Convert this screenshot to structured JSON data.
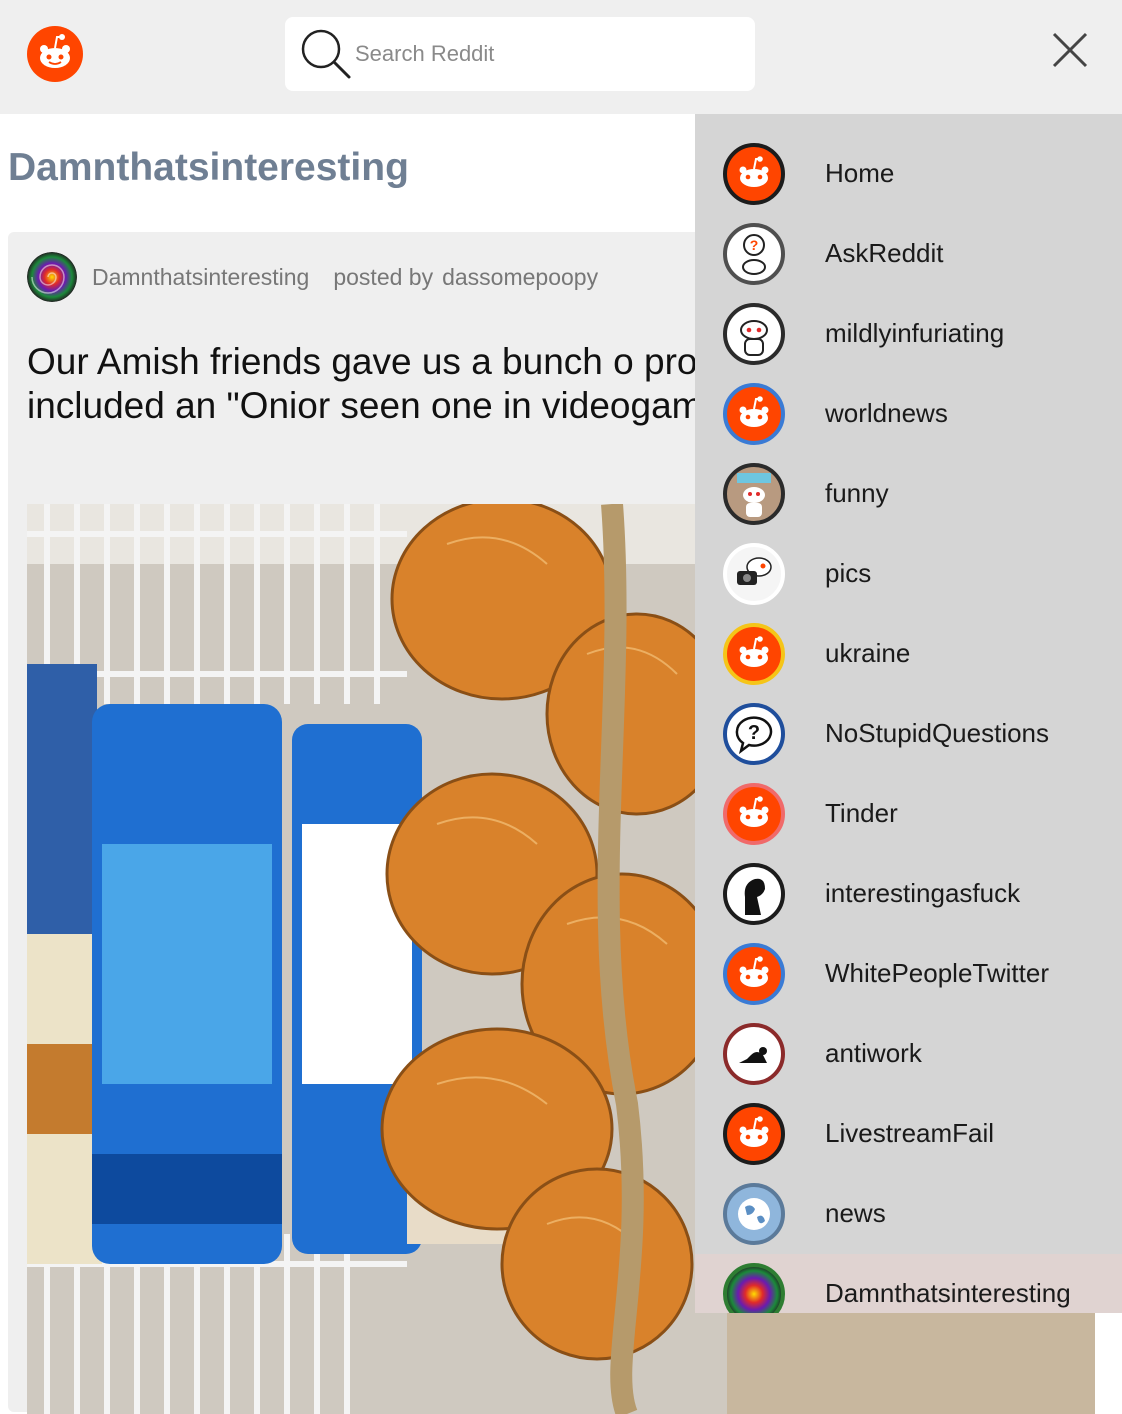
{
  "header": {
    "search_placeholder": "Search Reddit"
  },
  "page": {
    "subreddit_title": "Damnthatsinteresting"
  },
  "post": {
    "subreddit": "Damnthatsinteresting",
    "posted_by_label": "posted by",
    "author": "dassomepoopy",
    "title": "Our Amish friends gave us a bunch o produce and they included an \"Onior seen one in videogames."
  },
  "drawer": {
    "items": [
      {
        "label": "Home",
        "icon": "reddit-snoo-icon",
        "ring": "#1c1c1c"
      },
      {
        "label": "AskReddit",
        "icon": "askreddit-icon",
        "ring": "#4f4f4f"
      },
      {
        "label": "mildlyinfuriating",
        "icon": "mildlyinfuriating-icon",
        "ring": "#2b2b2b"
      },
      {
        "label": "worldnews",
        "icon": "reddit-snoo-icon",
        "ring": "#3a7bd5"
      },
      {
        "label": "funny",
        "icon": "funny-icon",
        "ring": "#2b2b2b"
      },
      {
        "label": "pics",
        "icon": "pics-icon",
        "ring": "#ffffff"
      },
      {
        "label": "ukraine",
        "icon": "reddit-snoo-icon",
        "ring": "#f5c518"
      },
      {
        "label": "NoStupidQuestions",
        "icon": "question-bubble-icon",
        "ring": "#1f4e9c"
      },
      {
        "label": "Tinder",
        "icon": "reddit-snoo-icon",
        "ring": "#f06a6a"
      },
      {
        "label": "interestingasfuck",
        "icon": "thinker-icon",
        "ring": "#1c1c1c"
      },
      {
        "label": "WhitePeopleTwitter",
        "icon": "reddit-snoo-icon",
        "ring": "#3a7bd5"
      },
      {
        "label": "antiwork",
        "icon": "antiwork-icon",
        "ring": "#8b2a2a"
      },
      {
        "label": "LivestreamFail",
        "icon": "reddit-snoo-icon",
        "ring": "#1c1c1c"
      },
      {
        "label": "news",
        "icon": "globe-icon",
        "ring": "#5b7a9a"
      },
      {
        "label": "Damnthatsinteresting",
        "icon": "swirl-icon",
        "ring": "#2e7d32",
        "active": true
      }
    ]
  },
  "colors": {
    "reddit_orange": "#ff4500",
    "topbar": "#efefef",
    "drawer": "#d5d5d5",
    "active_item": "#e0d3d1",
    "subtitle": "#6f7f93"
  }
}
